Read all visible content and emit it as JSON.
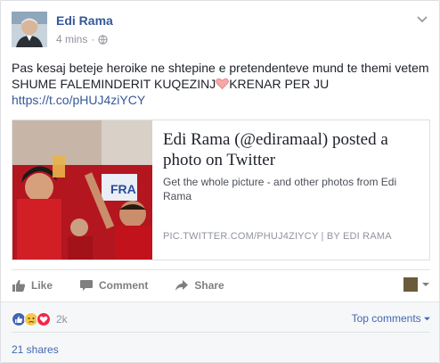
{
  "post": {
    "author": "Edi Rama",
    "timestamp": "4 mins",
    "separator": "·",
    "privacy_icon": "globe-icon",
    "text_part1": "Pas kesaj beteje heroike ne shtepine e pretendenteve mund te themi vetem SHUME FALEMINDERIT KUQEZINJ",
    "text_part2": "KRENAR PER JU",
    "link": "https://t.co/pHUJ4ziYCY"
  },
  "attachment": {
    "title": "Edi Rama (@ediramaal) posted a photo on Twitter",
    "description": "Get the whole picture - and other photos from Edi Rama",
    "source": "PIC.TWITTER.COM/PHUJ4ZIYCY | BY EDI RAMA"
  },
  "actions": {
    "like": "Like",
    "comment": "Comment",
    "share": "Share"
  },
  "reactions": {
    "count": "2k",
    "types": [
      "like",
      "sad",
      "love"
    ],
    "top_comments": "Top comments"
  },
  "shares": "21 shares",
  "colors": {
    "link": "#365899",
    "blue": "#4267b2",
    "muted": "#90949c",
    "albania_red": "#d0021b"
  }
}
